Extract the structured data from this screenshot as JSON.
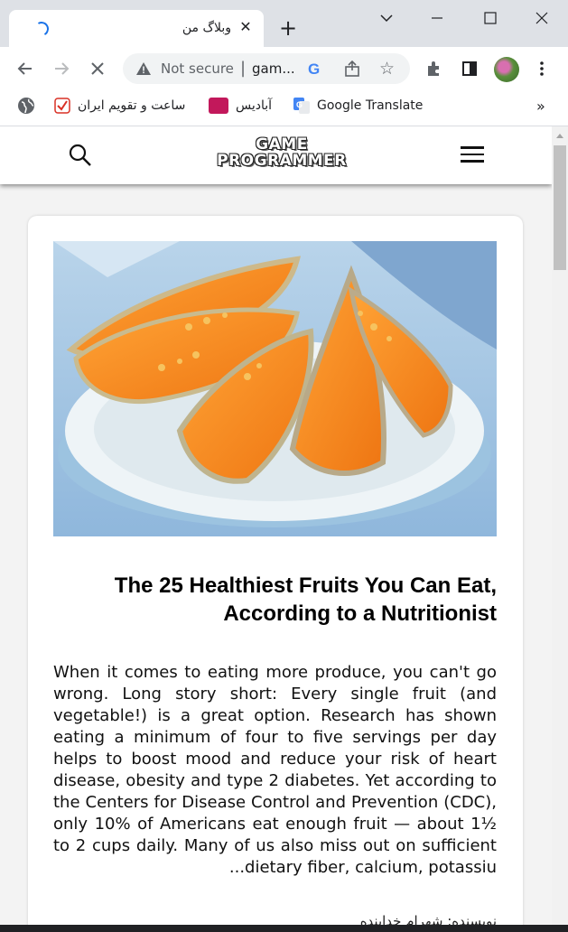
{
  "browser": {
    "tab_title": "وبلاگ من",
    "close_tab_glyph": "✕",
    "new_tab_glyph": "+",
    "security_label": "Not secure",
    "address_text": "gam...",
    "star_glyph": "☆",
    "bookmarks": [
      {
        "label": "ساعت و تقویم ایران",
        "icon": "checkmark-favicon"
      },
      {
        "label": "آبادیس",
        "icon": "abadis-favicon"
      },
      {
        "label": "Google Translate",
        "icon": "google-translate-favicon"
      }
    ],
    "overflow_glyph": "»"
  },
  "site": {
    "logo_line1": "GAME",
    "logo_line2": "PROGRAMMER"
  },
  "post": {
    "title": "The 25 Healthiest Fruits You Can Eat, According to a Nutritionist",
    "excerpt": "When it comes to eating more produce, you can't go wrong. Long story short: Every single fruit (and vegetable!) is a great option. Research has shown eating a minimum of four to five servings per day helps to boost mood and reduce your risk of heart disease, obesity and type 2 diabetes. Yet according to the Centers for Disease Control and Prevention (CDC), only 10% of Americans eat enough fruit — about 1½ to 2 cups daily. Many of us also miss out on sufficient ...dietary fiber, calcium, potassiu",
    "author": "نویسنده: شهرام خداینده"
  },
  "colors": {
    "accent": "#1a73e8",
    "tabstrip": "#dee1e6",
    "page_bg": "#f3f3f3",
    "melon_flesh": "#f08a1c"
  }
}
